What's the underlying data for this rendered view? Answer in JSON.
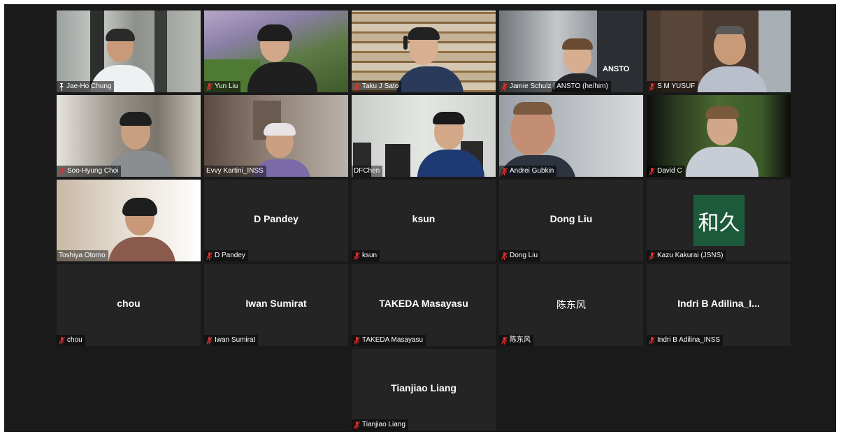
{
  "colors": {
    "background": "#1a1a1a",
    "tile": "#242424",
    "active_border": "#e8e46a",
    "muted_icon": "#e0302c",
    "avatar_bg": "#1d5a3c"
  },
  "participants": [
    {
      "name": "Jae-Ho Chung",
      "label_icon": "pin-icon",
      "video": true
    },
    {
      "name": "Yun Liu",
      "label_icon": "muted-mic-icon",
      "video": true
    },
    {
      "name": "Taku J Sato",
      "label_icon": "muted-mic-icon",
      "video": true
    },
    {
      "name": "Jamie Schulz | ANSTO (he/him)",
      "label_icon": "muted-mic-icon",
      "video": true,
      "watermark": "ANSTO"
    },
    {
      "name": "S M YUSUF",
      "label_icon": "muted-mic-icon",
      "video": true
    },
    {
      "name": "Soo-Hyung Choi",
      "label_icon": "muted-mic-icon",
      "video": true
    },
    {
      "name": "Evvy Kartini_INSS",
      "label_icon": "none",
      "video": true
    },
    {
      "name": "DFChen",
      "label_icon": "none",
      "video": true,
      "active_speaker": true
    },
    {
      "name": "Andrei Gubkin",
      "label_icon": "muted-mic-icon",
      "video": true
    },
    {
      "name": "David C",
      "label_icon": "muted-mic-icon",
      "video": true
    },
    {
      "name": "Toshiya Otomo",
      "label_icon": "none",
      "video": true
    },
    {
      "name": "D Pandey",
      "display": "D Pandey",
      "label_icon": "muted-mic-icon",
      "video": false
    },
    {
      "name": "ksun",
      "display": "ksun",
      "label_icon": "muted-mic-icon",
      "video": false
    },
    {
      "name": "Dong Liu",
      "display": "Dong Liu",
      "label_icon": "muted-mic-icon",
      "video": false
    },
    {
      "name": "Kazu Kakurai (JSNS)",
      "avatar_text": "和久",
      "label_icon": "muted-mic-icon",
      "video": false
    },
    {
      "name": "chou",
      "display": "chou",
      "label_icon": "muted-mic-icon",
      "video": false
    },
    {
      "name": "Iwan Sumirat",
      "display": "Iwan Sumirat",
      "label_icon": "muted-mic-icon",
      "video": false
    },
    {
      "name": "TAKEDA Masayasu",
      "display": "TAKEDA Masayasu",
      "label_icon": "muted-mic-icon",
      "video": false
    },
    {
      "name": "陈东风",
      "display": "陈东风",
      "label_icon": "muted-mic-icon",
      "video": false
    },
    {
      "name": "Indri B Adilina_INSS",
      "display": "Indri B Adilina_I...",
      "label_icon": "muted-mic-icon",
      "video": false
    },
    {
      "name": "Tianjiao Liang",
      "display": "Tianjiao Liang",
      "label_icon": "muted-mic-icon",
      "video": false
    }
  ]
}
